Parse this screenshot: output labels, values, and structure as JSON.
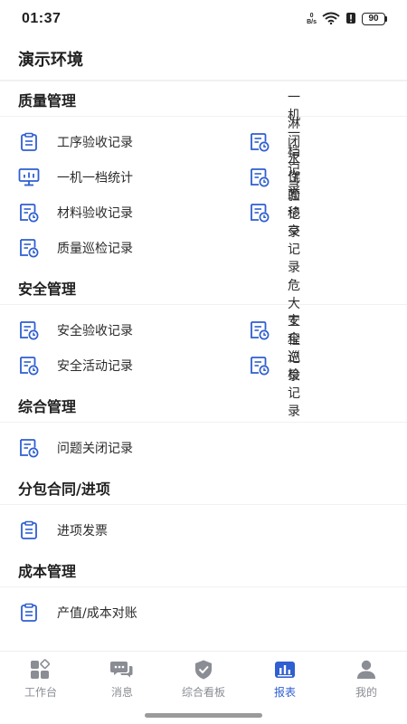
{
  "status_bar": {
    "time": "01:37",
    "net_speed_value": "0",
    "net_speed_unit": "B/s",
    "battery": "90"
  },
  "header": {
    "title": "演示环境"
  },
  "colors": {
    "accent": "#2f5fd0",
    "icon_blue": "#2f5fd0",
    "tab_inactive": "#8a8d93"
  },
  "sections": [
    {
      "title": "质量管理",
      "items": [
        {
          "label": "工序验收记录",
          "icon": "clipboard-icon"
        },
        {
          "label": "一机一档记录",
          "icon": "record-clock-icon"
        },
        {
          "label": "一机一档统计",
          "icon": "monitor-chart-icon"
        },
        {
          "label": "淋闭水试验记录",
          "icon": "record-clock-icon"
        },
        {
          "label": "材料验收记录",
          "icon": "record-clock-icon"
        },
        {
          "label": "工作面移交记录",
          "icon": "record-clock-icon"
        },
        {
          "label": "质量巡检记录",
          "icon": "record-clock-icon"
        }
      ]
    },
    {
      "title": "安全管理",
      "items": [
        {
          "label": "安全验收记录",
          "icon": "record-clock-icon"
        },
        {
          "label": "危大工程记录",
          "icon": "record-clock-icon"
        },
        {
          "label": "安全活动记录",
          "icon": "record-clock-icon"
        },
        {
          "label": "安全巡检记录",
          "icon": "record-clock-icon"
        }
      ]
    },
    {
      "title": "综合管理",
      "items": [
        {
          "label": "问题关闭记录",
          "icon": "record-clock-icon"
        }
      ]
    },
    {
      "title": "分包合同/进项",
      "items": [
        {
          "label": "进项发票",
          "icon": "clipboard-icon"
        }
      ]
    },
    {
      "title": "成本管理",
      "items": [
        {
          "label": "产值/成本对账",
          "icon": "clipboard-icon"
        }
      ]
    }
  ],
  "tabs": [
    {
      "label": "工作台",
      "icon": "workbench-icon",
      "active": false
    },
    {
      "label": "消息",
      "icon": "message-icon",
      "active": false
    },
    {
      "label": "综合看板",
      "icon": "shield-check-icon",
      "active": false
    },
    {
      "label": "报表",
      "icon": "bar-chart-icon",
      "active": true
    },
    {
      "label": "我的",
      "icon": "person-icon",
      "active": false
    }
  ]
}
